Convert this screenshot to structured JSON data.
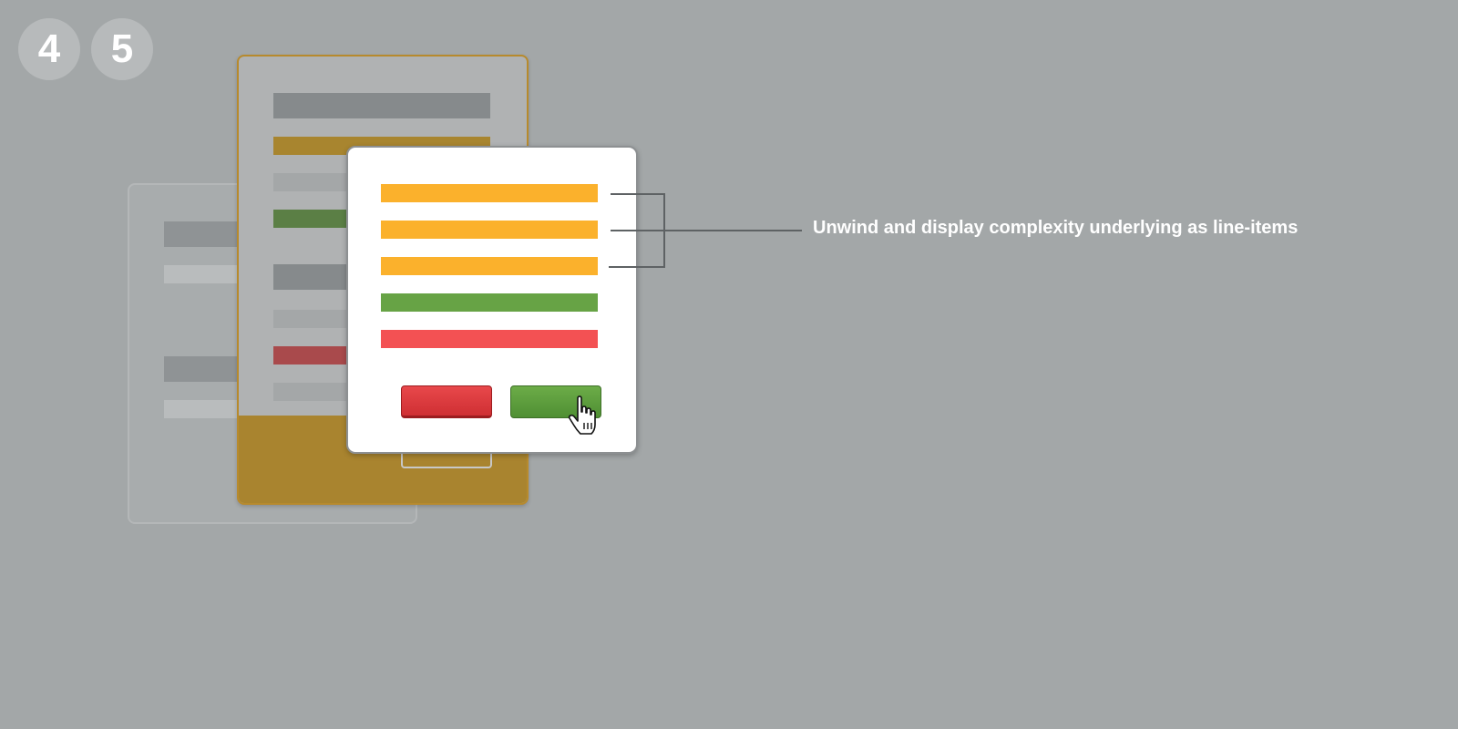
{
  "steps": [
    "4",
    "5"
  ],
  "callout": "Unwind and display complexity underlying as line-items",
  "colors": {
    "background": "#a3a7a8",
    "line_item_orange": "#fbb12c",
    "line_item_green": "#67a345",
    "line_item_red": "#f35153",
    "cancel_button": "#d83b3e",
    "confirm_button": "#5c9c3d",
    "highlight_card": "#a9842f"
  },
  "dialog": {
    "line_items": [
      {
        "status": "warning",
        "color": "#fbb12c"
      },
      {
        "status": "warning",
        "color": "#fbb12c"
      },
      {
        "status": "warning",
        "color": "#fbb12c"
      },
      {
        "status": "ok",
        "color": "#67a345"
      },
      {
        "status": "error",
        "color": "#f35153"
      }
    ],
    "buttons": [
      {
        "role": "cancel",
        "icon": "red-button"
      },
      {
        "role": "confirm",
        "icon": "green-button"
      }
    ]
  },
  "icons": {
    "cursor": "hand-pointer-icon"
  }
}
